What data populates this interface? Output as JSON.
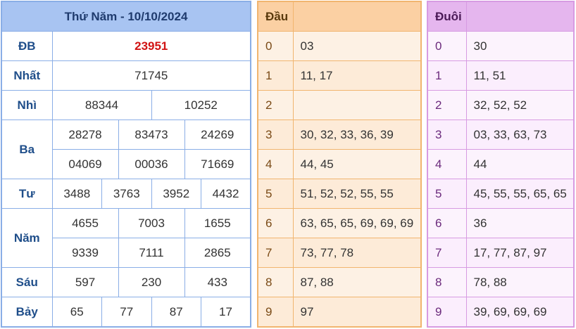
{
  "results": {
    "title": "Thứ Năm - 10/10/2024",
    "db": {
      "label": "ĐB",
      "values": [
        "23951"
      ]
    },
    "nhat": {
      "label": "Nhất",
      "values": [
        "71745"
      ]
    },
    "nhi": {
      "label": "Nhì",
      "values": [
        "88344",
        "10252"
      ]
    },
    "ba": {
      "label": "Ba",
      "values": [
        "28278",
        "83473",
        "24269",
        "04069",
        "00036",
        "71669"
      ]
    },
    "tu": {
      "label": "Tư",
      "values": [
        "3488",
        "3763",
        "3952",
        "4432"
      ]
    },
    "nam": {
      "label": "Năm",
      "values": [
        "4655",
        "7003",
        "1655",
        "9339",
        "7111",
        "2865"
      ]
    },
    "sau": {
      "label": "Sáu",
      "values": [
        "597",
        "230",
        "433"
      ]
    },
    "bay": {
      "label": "Bảy",
      "values": [
        "65",
        "77",
        "87",
        "17"
      ]
    }
  },
  "head": {
    "title": "Đầu",
    "rows": [
      {
        "k": "0",
        "v": "03"
      },
      {
        "k": "1",
        "v": "11, 17"
      },
      {
        "k": "2",
        "v": ""
      },
      {
        "k": "3",
        "v": "30, 32, 33, 36, 39"
      },
      {
        "k": "4",
        "v": "44, 45"
      },
      {
        "k": "5",
        "v": "51, 52, 52, 55, 55"
      },
      {
        "k": "6",
        "v": "63, 65, 65, 69, 69, 69"
      },
      {
        "k": "7",
        "v": "73, 77, 78"
      },
      {
        "k": "8",
        "v": "87, 88"
      },
      {
        "k": "9",
        "v": "97"
      }
    ]
  },
  "tail": {
    "title": "Đuôi",
    "rows": [
      {
        "k": "0",
        "v": "30"
      },
      {
        "k": "1",
        "v": "11, 51"
      },
      {
        "k": "2",
        "v": "32, 52, 52"
      },
      {
        "k": "3",
        "v": "03, 33, 63, 73"
      },
      {
        "k": "4",
        "v": "44"
      },
      {
        "k": "5",
        "v": "45, 55, 55, 65, 65"
      },
      {
        "k": "6",
        "v": "36"
      },
      {
        "k": "7",
        "v": "17, 77, 87, 97"
      },
      {
        "k": "8",
        "v": "78, 88"
      },
      {
        "k": "9",
        "v": "39, 69, 69, 69"
      }
    ]
  },
  "colors": {
    "special_prize": "#d11313",
    "results_border": "#8aaee6",
    "head_border": "#f1b56f",
    "tail_border": "#d79be2"
  }
}
